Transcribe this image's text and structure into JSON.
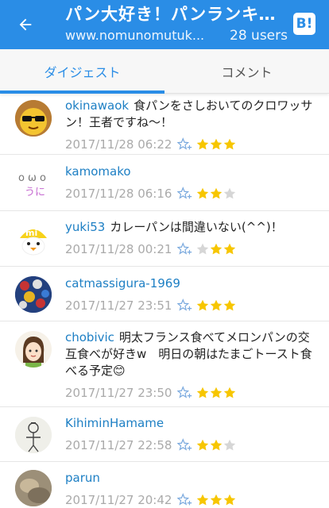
{
  "header": {
    "title": "パン大好き！パンランキン...",
    "url": "www.nomunomutuk...",
    "users": "28 users",
    "hatena_badge": "B!"
  },
  "tabs": [
    {
      "label": "ダイジェスト",
      "active": true
    },
    {
      "label": "コメント",
      "active": false
    }
  ],
  "colors": {
    "accent": "#2a8de6",
    "star_filled": "#f7c600",
    "star_empty": "#d6d6d6",
    "username": "#1d7fc4"
  },
  "comments": [
    {
      "user": "okinawaok",
      "text": "食パンをさしおいてのクロワッサン！王者ですね〜！",
      "date": "2017/11/28 06:22",
      "stars": 3,
      "avatar": "sunglasses-face-avatar"
    },
    {
      "user": "kamomako",
      "text": "",
      "date": "2017/11/28 06:16",
      "stars": 2,
      "avatar": "kawaii-face-avatar"
    },
    {
      "user": "yuki53",
      "text": "カレーパンは間違いない(^^)！",
      "date": "2017/11/28 00:21",
      "stars": 2,
      "avatar": "chick-avatar"
    },
    {
      "user": "catmassigura-1969",
      "text": "",
      "date": "2017/11/27 23:51",
      "stars": 3,
      "avatar": "bottle-caps-avatar"
    },
    {
      "user": "chobivic",
      "text": "明太フランス食べてメロンパンの交互食べが好きw　明日の朝はたまごトースト食べる予定😊",
      "date": "2017/11/27 23:50",
      "stars": 3,
      "avatar": "girl-illustration-avatar"
    },
    {
      "user": "KihiminHamame",
      "text": "",
      "date": "2017/11/27 22:58",
      "stars": 2,
      "avatar": "sketch-figure-avatar"
    },
    {
      "user": "parun",
      "text": "",
      "date": "2017/11/27 20:42",
      "stars": 3,
      "avatar": "photo-avatar"
    }
  ]
}
